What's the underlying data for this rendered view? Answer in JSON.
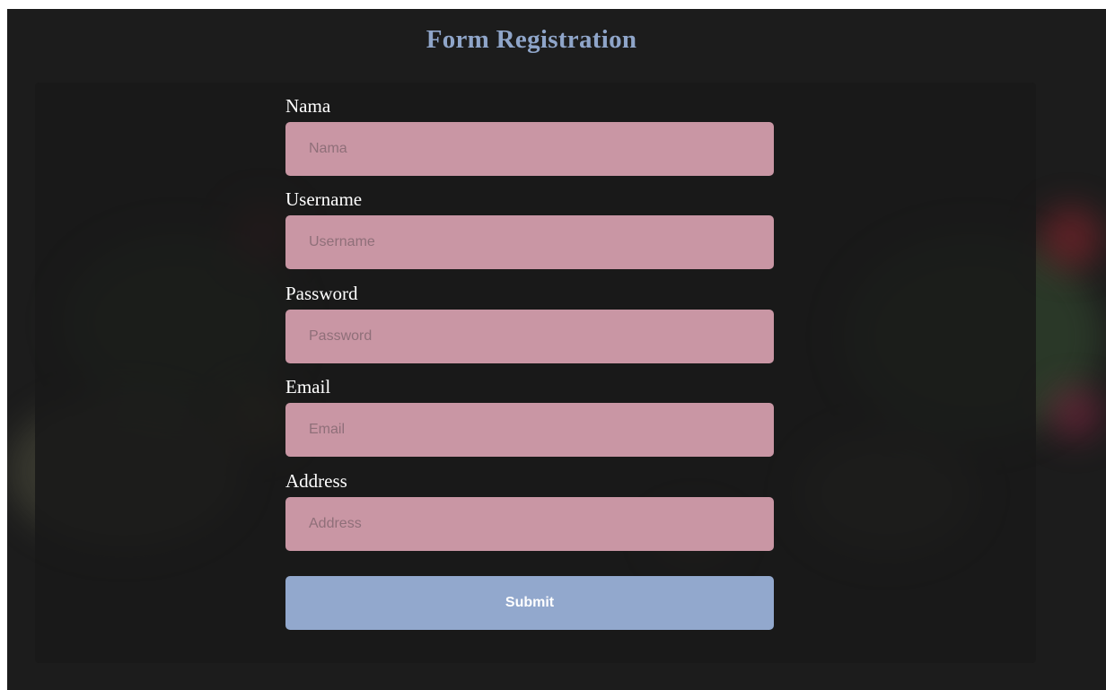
{
  "page": {
    "title": "Form Registration"
  },
  "form": {
    "fields": [
      {
        "label": "Nama",
        "placeholder": "Nama",
        "value": ""
      },
      {
        "label": "Username",
        "placeholder": "Username",
        "value": ""
      },
      {
        "label": "Password",
        "placeholder": "Password",
        "value": ""
      },
      {
        "label": "Email",
        "placeholder": "Email",
        "value": ""
      },
      {
        "label": "Address",
        "placeholder": "Address",
        "value": ""
      }
    ],
    "submit_label": "Submit"
  },
  "colors": {
    "title": "#8fa5c9",
    "input_background": "#c996a4",
    "submit_background": "#92a8cd",
    "panel_background": "#181818"
  }
}
